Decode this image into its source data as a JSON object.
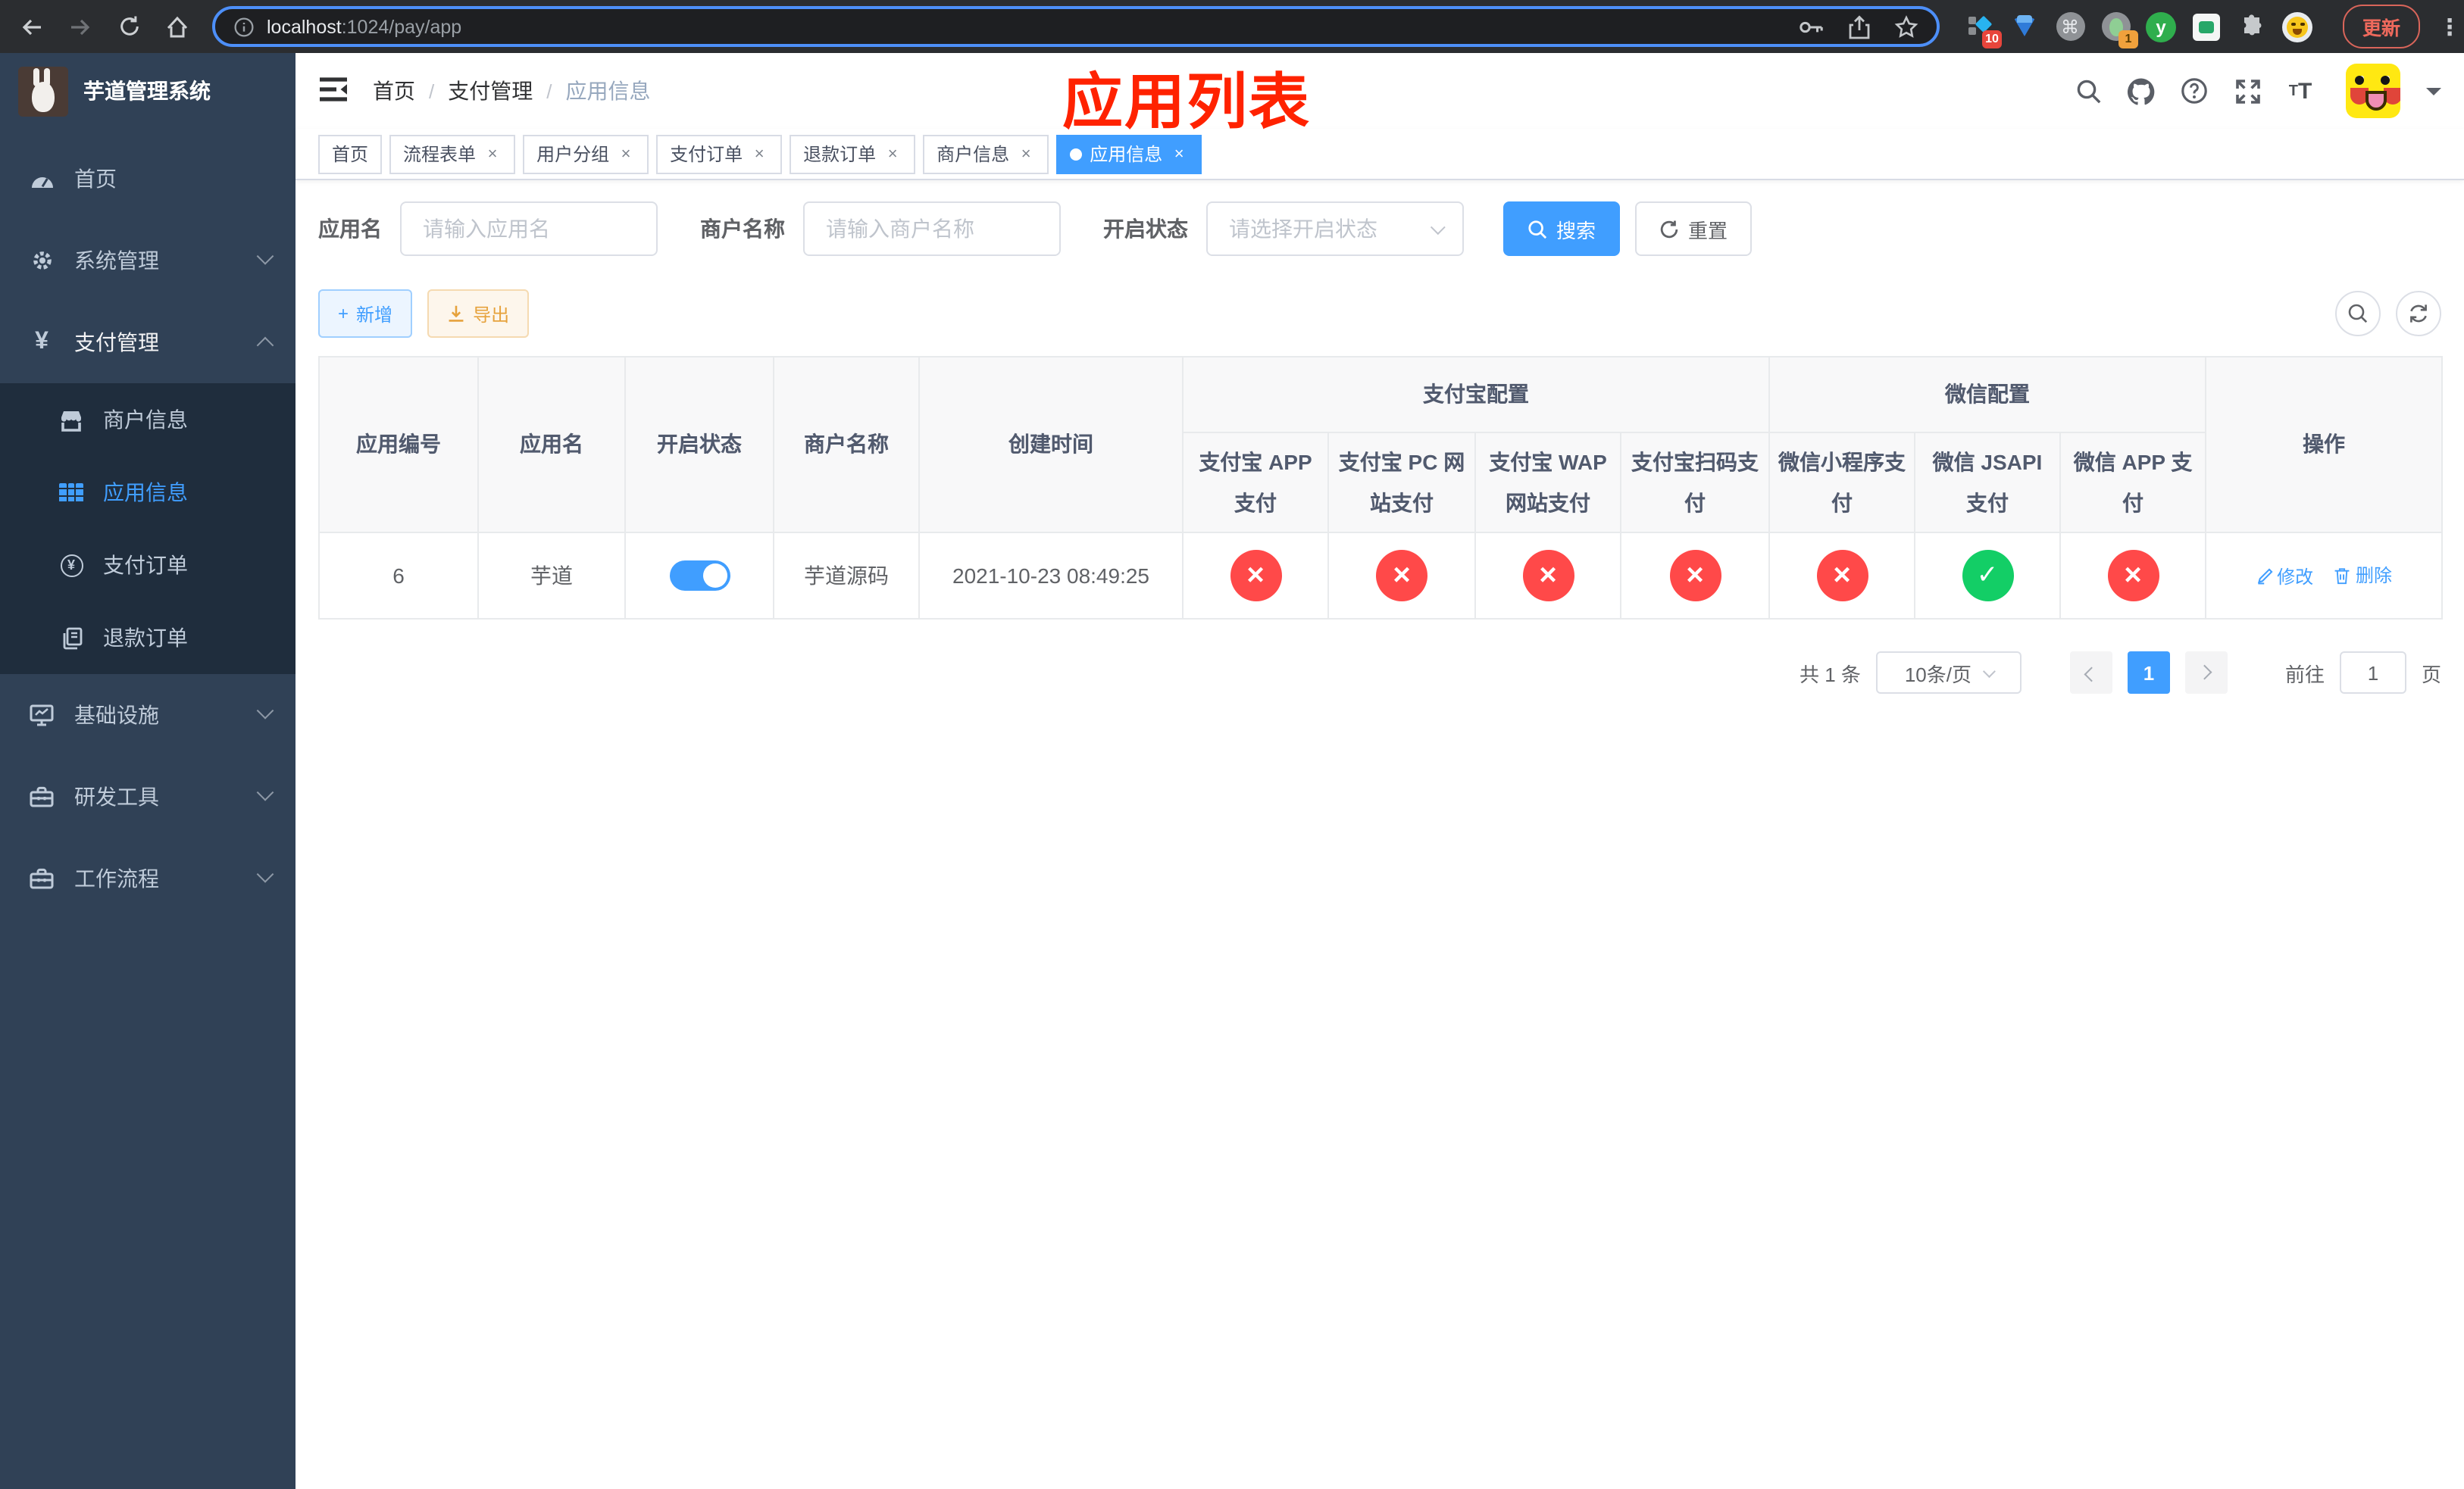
{
  "colors": {
    "primary": "#409eff",
    "danger": "#ff4949",
    "success": "#13ce66",
    "warning": "#e6a23c",
    "annotation_red": "#ff2200",
    "sidebar_bg": "#304156",
    "submenu_bg": "#1f2d3d"
  },
  "browser": {
    "url_host": "localhost",
    "url_path": ":1024/pay/app",
    "update_label": "更新",
    "ext_badge_blocks": "10",
    "ext_badge_oval": "1",
    "command_glyph": "⌘",
    "ext_y_glyph": "y"
  },
  "sidebar": {
    "title": "芋道管理系统",
    "items": [
      {
        "label": "首页"
      },
      {
        "label": "系统管理"
      },
      {
        "label": "支付管理"
      },
      {
        "label": "基础设施"
      },
      {
        "label": "研发工具"
      },
      {
        "label": "工作流程"
      }
    ],
    "submenu": [
      {
        "label": "商户信息"
      },
      {
        "label": "应用信息"
      },
      {
        "label": "支付订单"
      },
      {
        "label": "退款订单"
      }
    ]
  },
  "breadcrumb": {
    "items": [
      "首页",
      "支付管理",
      "应用信息"
    ],
    "separator": "/"
  },
  "annotation": "应用列表",
  "tabs": [
    {
      "label": "首页"
    },
    {
      "label": "流程表单"
    },
    {
      "label": "用户分组"
    },
    {
      "label": "支付订单"
    },
    {
      "label": "退款订单"
    },
    {
      "label": "商户信息"
    },
    {
      "label": "应用信息"
    }
  ],
  "filters": {
    "app_name_label": "应用名",
    "app_name_placeholder": "请输入应用名",
    "merchant_label": "商户名称",
    "merchant_placeholder": "请输入商户名称",
    "status_label": "开启状态",
    "status_placeholder": "请选择开启状态",
    "search_label": "搜索",
    "reset_label": "重置"
  },
  "toolbar": {
    "add_label": "新增",
    "export_label": "导出"
  },
  "table": {
    "plain_headers": [
      "应用编号",
      "应用名",
      "开启状态",
      "商户名称",
      "创建时间"
    ],
    "group1": "支付宝配置",
    "group1_cols": [
      "支付宝 APP 支付",
      "支付宝 PC 网站支付",
      "支付宝 WAP 网站支付",
      "支付宝扫码支付"
    ],
    "group2": "微信配置",
    "group2_cols": [
      "微信小程序支付",
      "微信 JSAPI 支付",
      "微信 APP 支付"
    ],
    "actions_header": "操作",
    "row": {
      "id": "6",
      "name": "芋道",
      "enabled": true,
      "merchant": "芋道源码",
      "created": "2021-10-23 08:49:25",
      "statuses": [
        "close",
        "close",
        "close",
        "close",
        "close",
        "check",
        "close"
      ],
      "edit_label": "修改",
      "delete_label": "删除"
    }
  },
  "pagination": {
    "total": "共 1 条",
    "size": "10条/页",
    "page": "1",
    "goto_label": "前往",
    "goto_value": "1",
    "unit_label": "页"
  }
}
